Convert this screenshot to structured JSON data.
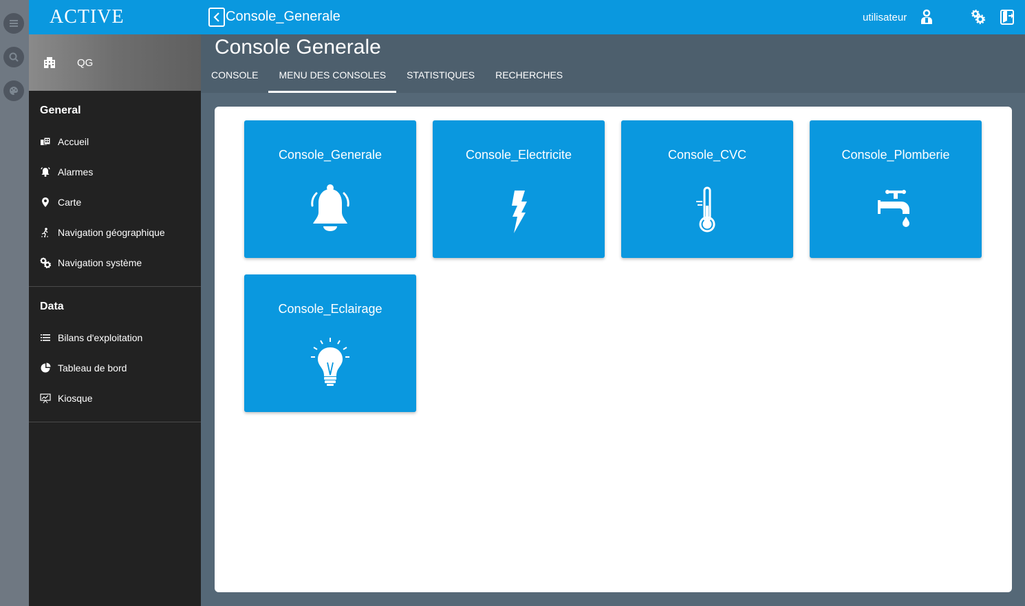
{
  "app": {
    "logo": "ACTIVE"
  },
  "sidebar": {
    "site": "QG",
    "sections": [
      {
        "title": "General",
        "items": [
          {
            "label": "Accueil",
            "icon": "home-icon"
          },
          {
            "label": "Alarmes",
            "icon": "alarm-bell-icon"
          },
          {
            "label": "Carte",
            "icon": "map-pin-icon"
          },
          {
            "label": "Navigation géographique",
            "icon": "geo-navigation-icon"
          },
          {
            "label": "Navigation système",
            "icon": "system-gears-icon"
          }
        ]
      },
      {
        "title": "Data",
        "items": [
          {
            "label": "Bilans d'exploitation",
            "icon": "list-icon"
          },
          {
            "label": "Tableau de bord",
            "icon": "pie-chart-icon"
          },
          {
            "label": "Kiosque",
            "icon": "presentation-icon"
          }
        ]
      }
    ]
  },
  "topbar": {
    "title": "Console_Generale",
    "user": "utilisateur"
  },
  "page": {
    "title": "Console Generale",
    "tabs": [
      "CONSOLE",
      "MENU DES CONSOLES",
      "STATISTIQUES",
      "RECHERCHES"
    ],
    "active_tab": "MENU DES CONSOLES"
  },
  "consoles": [
    {
      "label": "Console_Generale",
      "icon": "bell-icon"
    },
    {
      "label": "Console_Electricite",
      "icon": "lightning-icon"
    },
    {
      "label": "Console_CVC",
      "icon": "thermometer-icon"
    },
    {
      "label": "Console_Plomberie",
      "icon": "faucet-icon"
    },
    {
      "label": "Console_Eclairage",
      "icon": "lightbulb-icon"
    }
  ],
  "colors": {
    "accent": "#0a98df",
    "sidebar": "#222222",
    "header": "#4d5f6d",
    "background": "#556877"
  }
}
